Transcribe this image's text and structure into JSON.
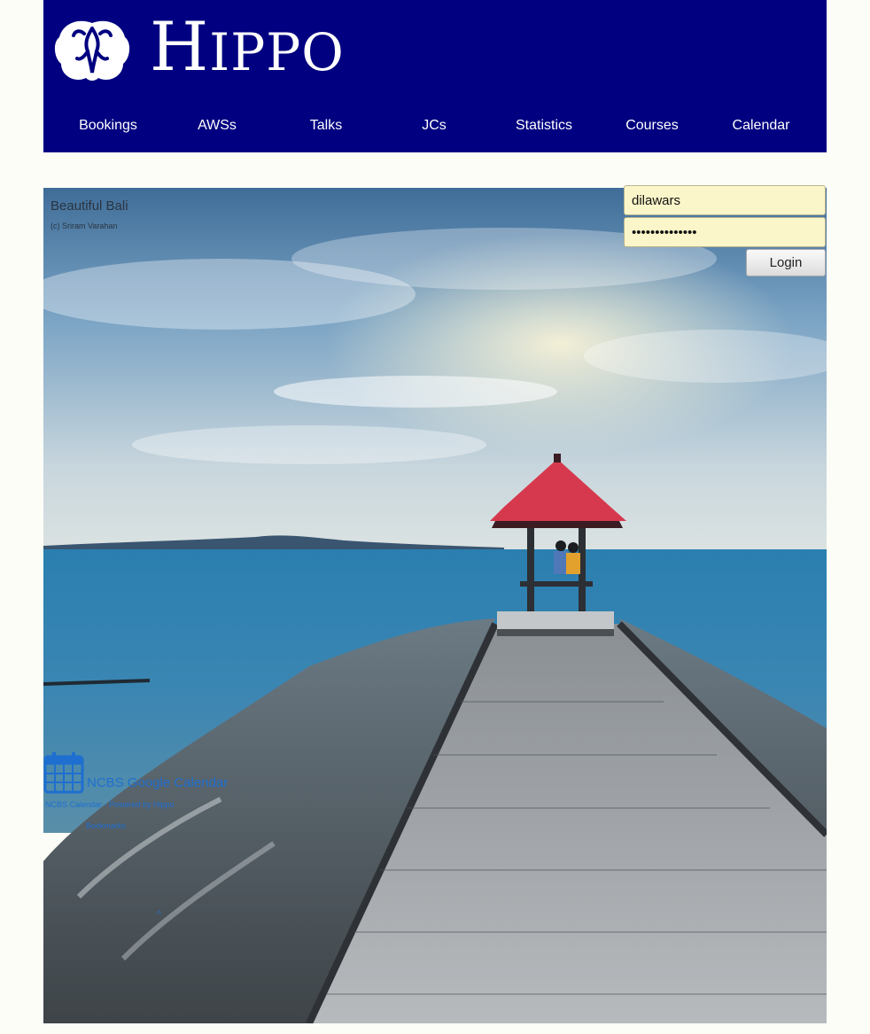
{
  "header": {
    "brand_first": "H",
    "brand_rest": "IPPO",
    "logo_icon": "brain-logo-icon",
    "background": "#000080"
  },
  "nav": {
    "items": [
      {
        "label": "Bookings"
      },
      {
        "label": "AWSs"
      },
      {
        "label": "Talks"
      },
      {
        "label": "JCs"
      },
      {
        "label": "Statistics"
      },
      {
        "label": "Courses"
      },
      {
        "label": "Calendar"
      }
    ]
  },
  "hero": {
    "title": "Beautiful Bali",
    "credit": "(c) Sriram Varahan"
  },
  "login": {
    "username": "dilawars",
    "password": "••••••••••••••",
    "button_label": "Login",
    "field_color": "#fbf6c9"
  },
  "calendar_link": {
    "icon": "calendar-icon",
    "label": "NCBS Google Calendar",
    "sub1": "NCBS Calendar - Powered by Hippo",
    "sub2": "Bookmarks",
    "color": "#1e6fd0"
  }
}
